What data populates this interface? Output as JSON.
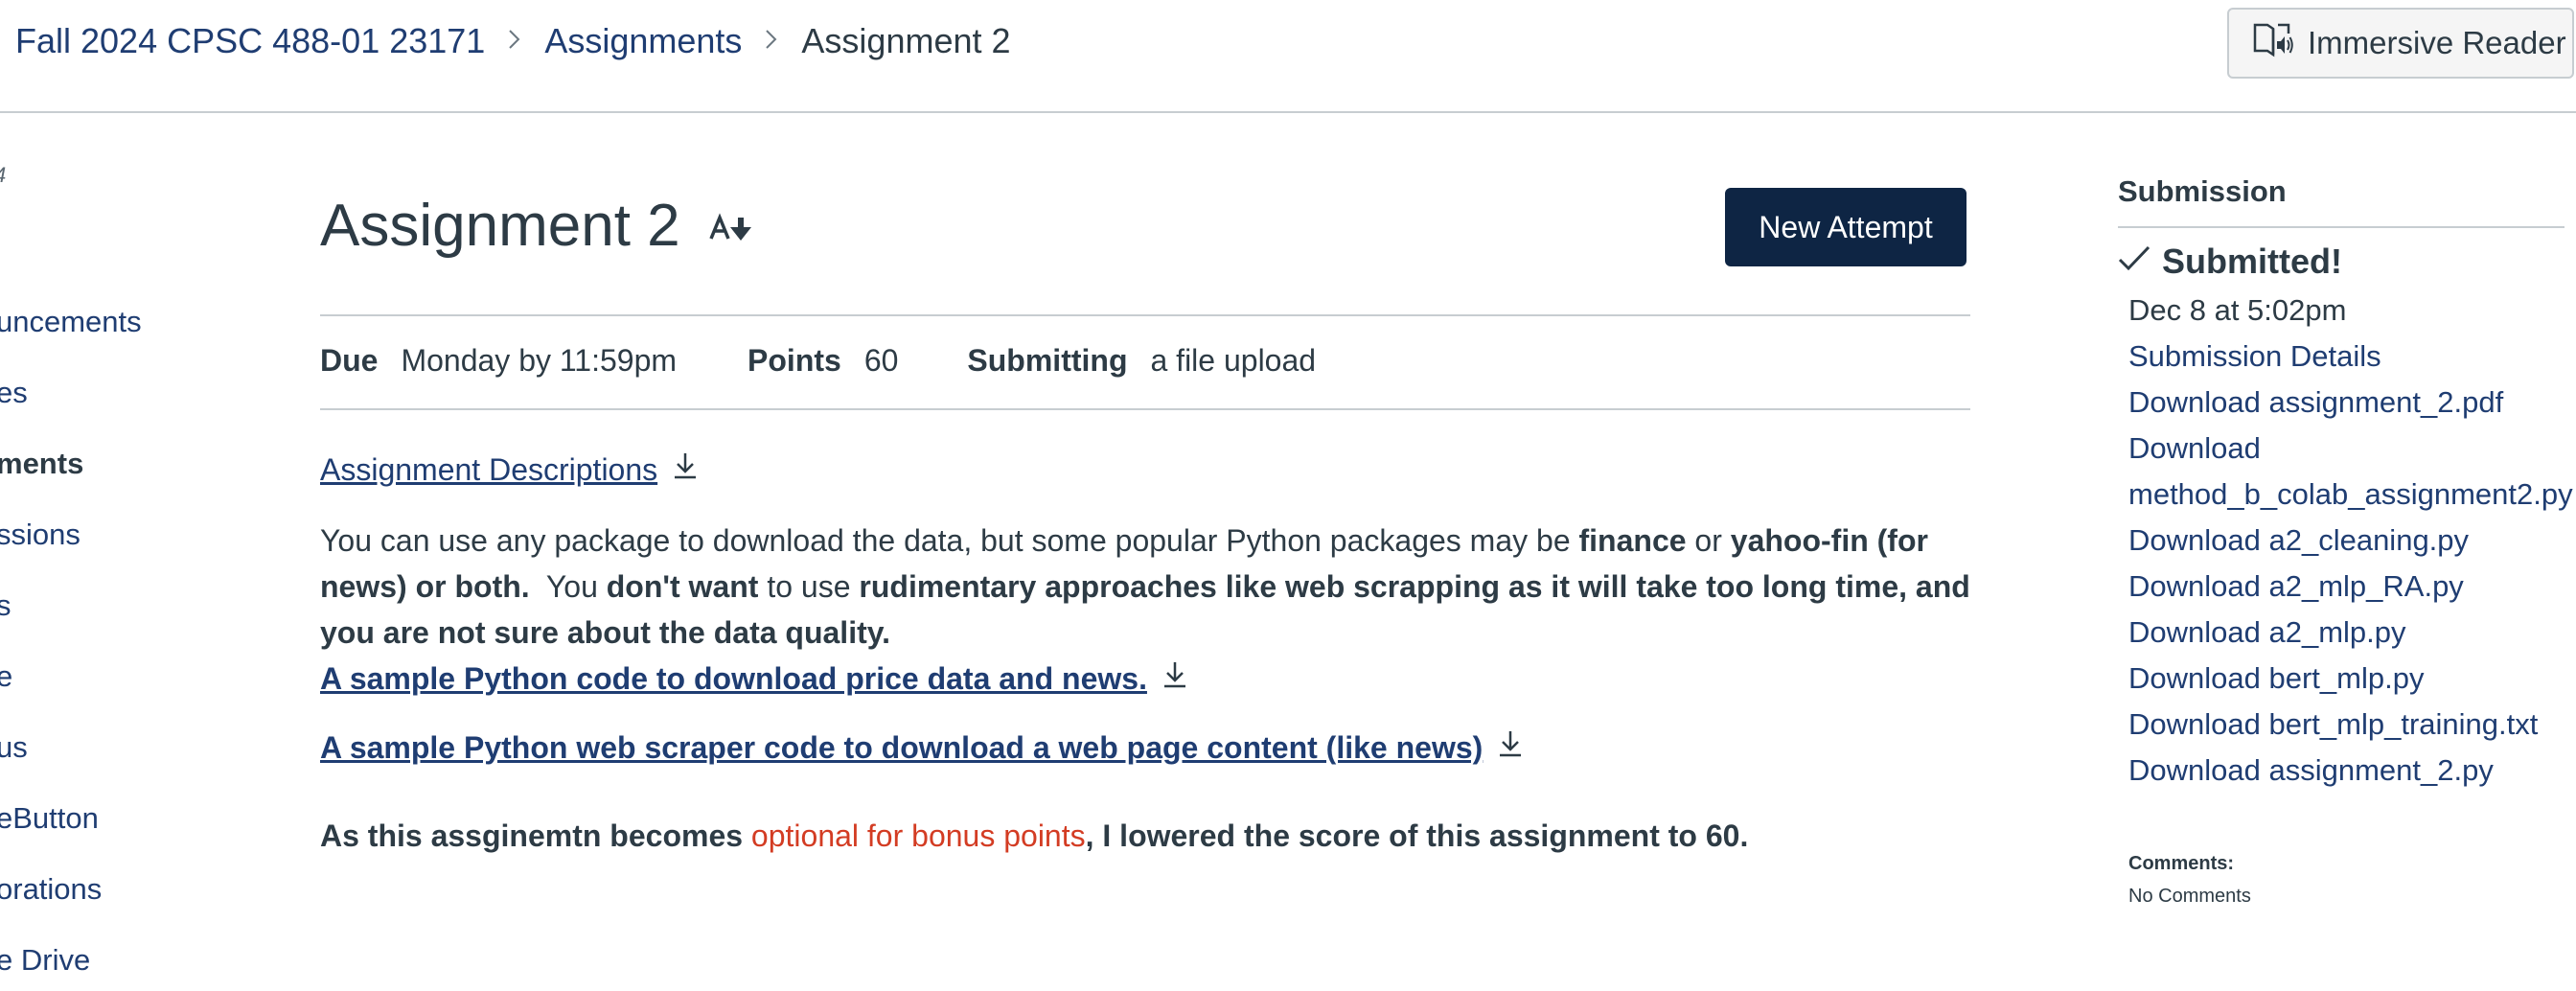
{
  "breadcrumb": {
    "course": "Fall 2024 CPSC 488-01 23171",
    "section": "Assignments",
    "current": "Assignment 2"
  },
  "header": {
    "immersive_reader_label": "Immersive Reader"
  },
  "left_nav": {
    "term_fragment": "4",
    "items": [
      {
        "label": "uncements",
        "active": false
      },
      {
        "label": "es",
        "active": false
      },
      {
        "label": "ments",
        "active": true
      },
      {
        "label": "ssions",
        "active": false
      },
      {
        "label": "s",
        "active": false
      },
      {
        "label": "e",
        "active": false
      },
      {
        "label": "us",
        "active": false
      },
      {
        "label": "eButton",
        "active": false
      },
      {
        "label": "orations",
        "active": false
      },
      {
        "label": "e Drive",
        "active": false
      }
    ]
  },
  "assignment": {
    "title": "Assignment 2",
    "new_attempt_label": "New Attempt",
    "due_label": "Due",
    "due_value": "Monday by 11:59pm",
    "points_label": "Points",
    "points_value": "60",
    "submitting_label": "Submitting",
    "submitting_value": "a file upload"
  },
  "description": {
    "descriptions_link": "Assignment Descriptions",
    "para_1": "You can use any package to download the data, but some popular Python packages may be ",
    "para_finance": "finance",
    "para_2": " or ",
    "para_yahoo": "yahoo-fin (for news) or both.",
    "para_3": "  You ",
    "para_dont": "don't want",
    "para_4": " to use ",
    "para_rudimentary": "rudimentary approaches like web scrapping as it will take too long time, and you are not sure about the data quality.",
    "sample_link_1": "A sample Python code to download price data and news.",
    "sample_link_2": "A sample Python web scraper code to download a web page content (like news)",
    "note_1": "As this assginemtn becomes ",
    "note_red": "optional for bonus points",
    "note_2": ", I lowered the score of this assignment to 60."
  },
  "submission": {
    "heading": "Submission",
    "status": "Submitted!",
    "date": "Dec 8 at 5:02pm",
    "details_link": "Submission Details",
    "files": [
      "Download assignment_2.pdf",
      "Download",
      "method_b_colab_assignment2.py",
      "Download a2_cleaning.py",
      "Download a2_mlp_RA.py",
      "Download a2_mlp.py",
      "Download bert_mlp.py",
      "Download bert_mlp_training.txt",
      "Download assignment_2.py"
    ],
    "comments_label": "Comments:",
    "comments_value": "No Comments"
  },
  "colors": {
    "link": "#1f3d72",
    "text": "#2d3b45",
    "primary_button": "#0e2544",
    "highlight_red": "#d33c23",
    "rule": "#c7cdd1"
  },
  "icons": [
    "chevron-right-icon",
    "immersive-reader-icon",
    "ai-icon",
    "download-icon",
    "checkmark-icon"
  ]
}
